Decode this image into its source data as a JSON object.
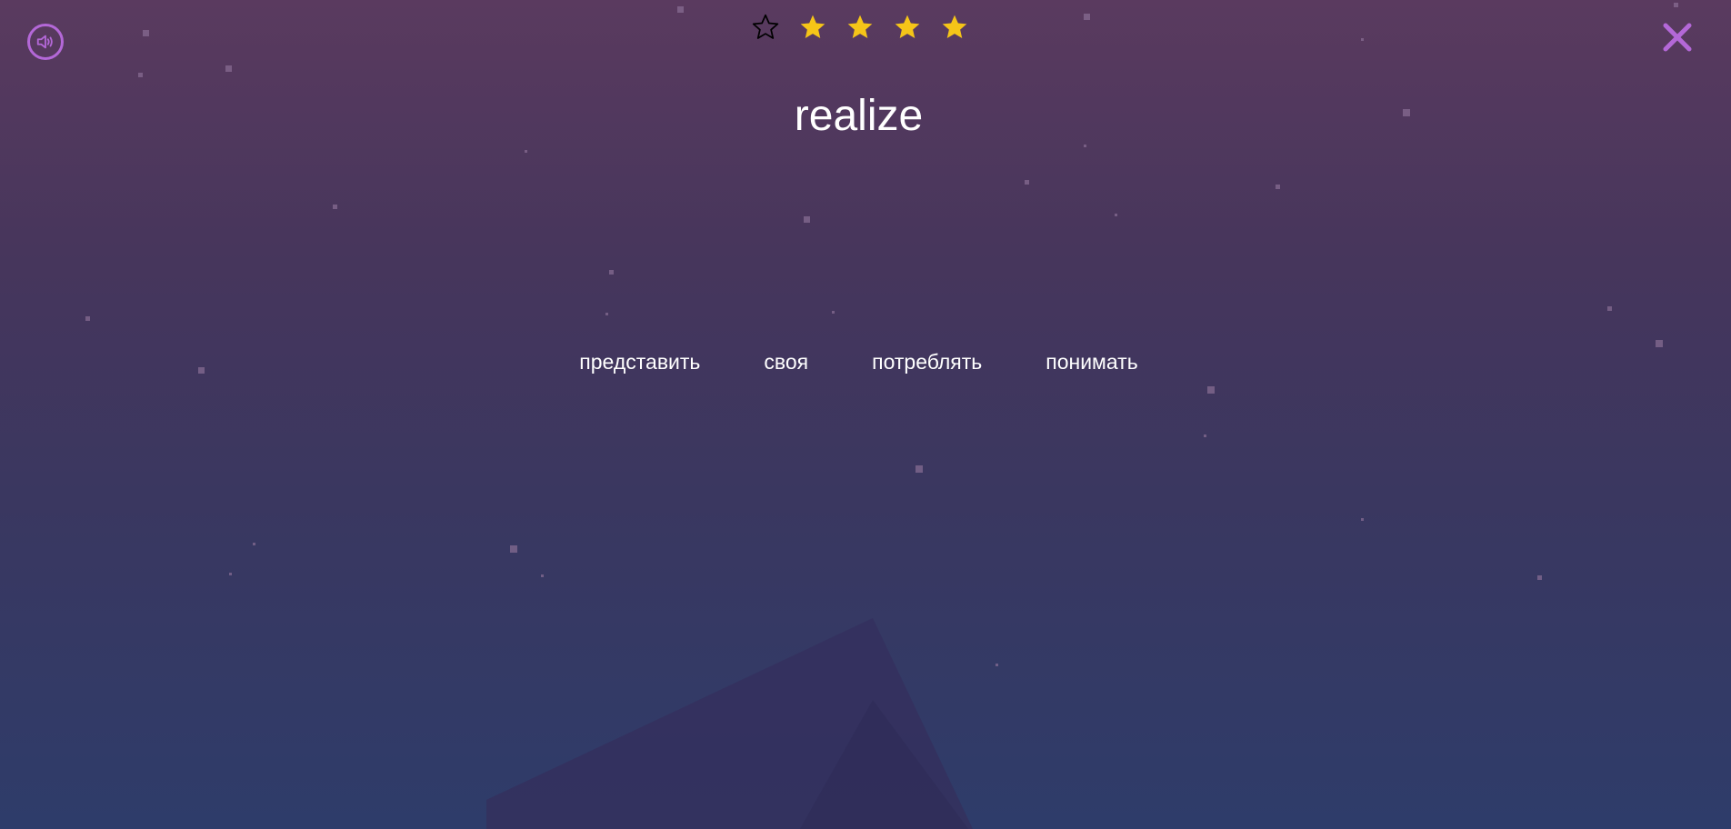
{
  "rating": {
    "total_stars": 5,
    "filled_stars": 4,
    "icons": [
      "star-outline-icon",
      "star-filled-icon",
      "star-filled-icon",
      "star-filled-icon",
      "star-filled-icon"
    ],
    "filled_color": "#f5c518",
    "empty_color": "#000000"
  },
  "controls": {
    "sound_icon": "speaker-icon",
    "close_icon": "close-icon",
    "accent_color": "#b468d8"
  },
  "quiz": {
    "word": "realize",
    "options": [
      "представить",
      "своя",
      "потреблять",
      "понимать"
    ]
  },
  "background": {
    "decorations": [
      "moon-icon",
      "stars",
      "mountains"
    ]
  }
}
